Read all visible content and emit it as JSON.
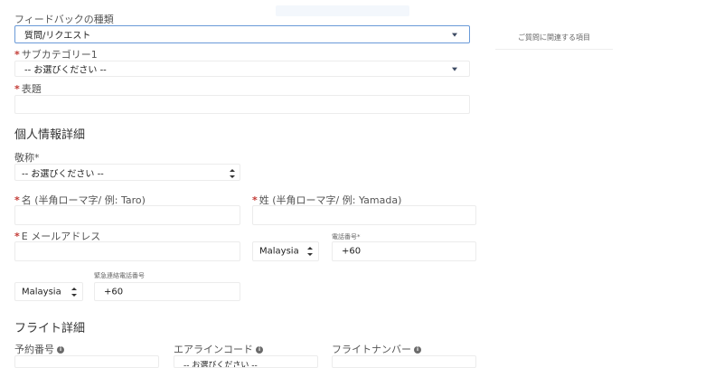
{
  "feedback": {
    "type_label": "フィードバックの種類",
    "type_value": "質問/リクエスト",
    "subcategory_label": "サブカテゴリー1",
    "subcategory_value": "-- お選びください --",
    "subject_label": "表題"
  },
  "related": {
    "label": "ご質問に関連する項目"
  },
  "personal": {
    "section_title": "個人情報詳細",
    "title_label": "敬称*",
    "title_value": "-- お選びください --",
    "first_name_label": "名 (半角ローマ字/ 例: Taro)",
    "last_name_label": "姓 (半角ローマ字/ 例: Yamada)",
    "email_label": "E メールアドレス",
    "phone_label": "電話番号*",
    "phone_country": "Malaysia",
    "phone_code": "+60",
    "emergency_label": "緊急連絡電話番号",
    "emergency_country": "Malaysia",
    "emergency_code": "+60"
  },
  "flight": {
    "section_title": "フライト詳細",
    "booking_label": "予約番号",
    "airline_label": "エアラインコード",
    "airline_value": "-- お選びください --",
    "flight_number_label": "フライトナンバー"
  },
  "icons": {
    "info": "info-icon",
    "dropdown": "chevron-down-icon",
    "updown": "sort-arrows-icon"
  },
  "colors": {
    "required": "#c23934",
    "focus_border": "#6a9ad8",
    "caret": "#3b4a63"
  }
}
